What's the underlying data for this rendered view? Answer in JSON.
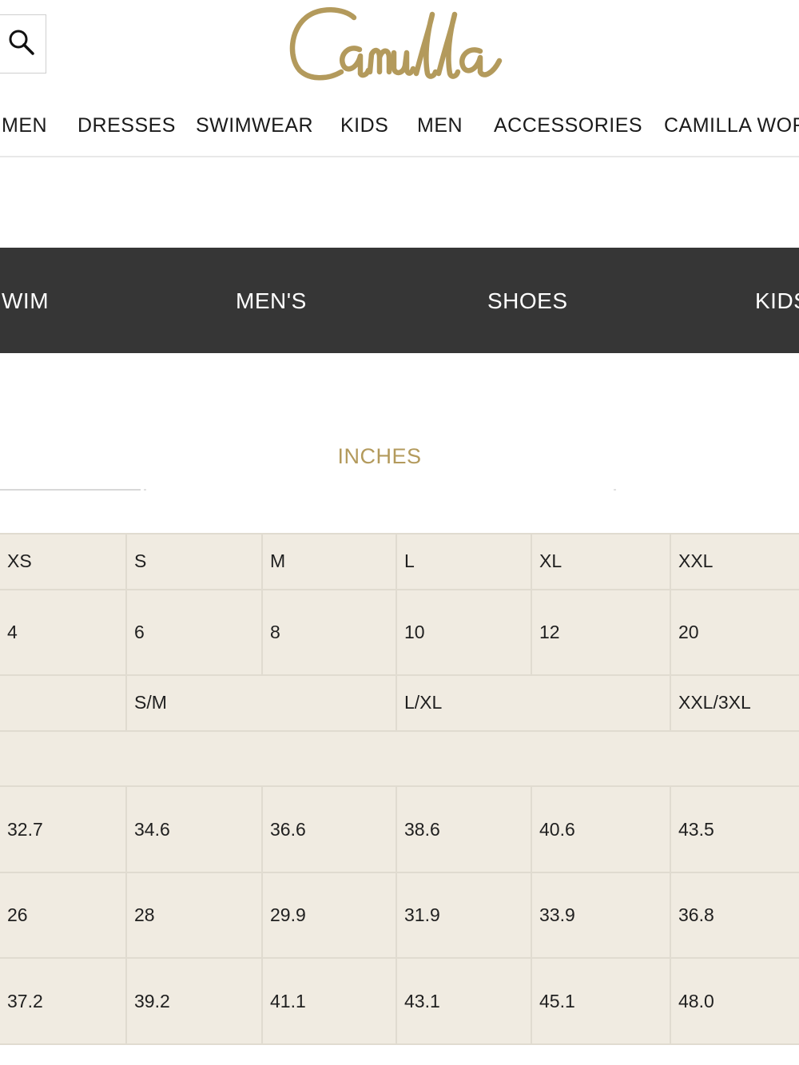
{
  "brand": {
    "logo_text": "Camilla",
    "logo_color": "#b39a5c"
  },
  "search": {
    "icon": "search-icon"
  },
  "top_nav": {
    "items": [
      "MEN",
      "DRESSES",
      "SWIMWEAR",
      "KIDS",
      "MEN",
      "ACCESSORIES",
      "CAMILLA WOR"
    ]
  },
  "category_bar": {
    "background": "#363636",
    "items": [
      "WIM",
      "MEN'S",
      "SHOES",
      "KIDS"
    ]
  },
  "units": {
    "active_label": "INCHES",
    "accent": "#b39a5c"
  },
  "size_table": {
    "background": "#f0ebe1",
    "header": [
      "XS",
      "S",
      "M",
      "L",
      "XL",
      "XXL"
    ],
    "au_sizes": [
      "4",
      "6",
      "8",
      "10",
      "12",
      "20"
    ],
    "group_sizes": [
      "",
      "S/M",
      "L/XL",
      "XXL/3XL"
    ],
    "measurements": [
      [
        "32.7",
        "34.6",
        "36.6",
        "38.6",
        "40.6",
        "43.5"
      ],
      [
        "26",
        "28",
        "29.9",
        "31.9",
        "33.9",
        "36.8"
      ],
      [
        "37.2",
        "39.2",
        "41.1",
        "43.1",
        "45.1",
        "48.0"
      ]
    ]
  }
}
